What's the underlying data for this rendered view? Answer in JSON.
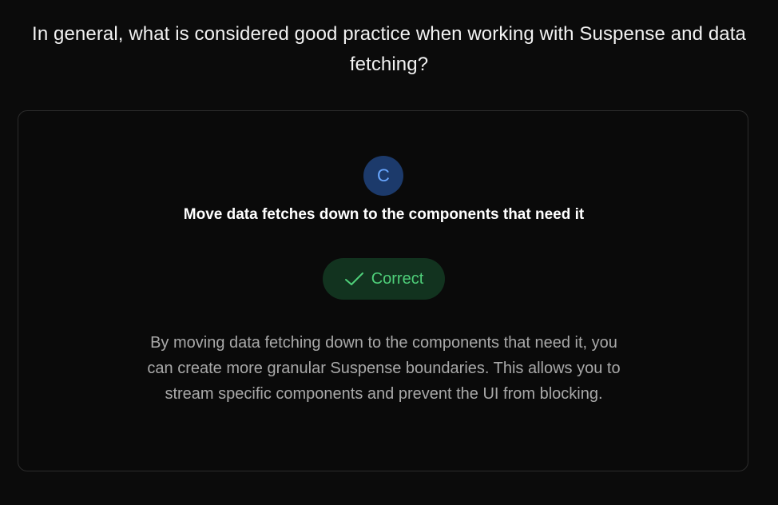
{
  "question": {
    "text": "In general, what is considered good practice when working with Suspense and data fetching?"
  },
  "result": {
    "choice_letter": "C",
    "answer_text": "Move data fetches down to the components that need it",
    "status_label": "Correct",
    "status_icon": "checkmark-icon",
    "explanation": "By moving data fetching down to the components that need it, you can create more granular Suspense boundaries. This allows you to stream specific components and prevent the UI from blocking."
  },
  "colors": {
    "background": "#0b0b0b",
    "card_border": "#2c2c2c",
    "choice_bg": "#1c3a6b",
    "choice_text": "#69a7ff",
    "correct_bg": "#12331f",
    "correct_text": "#4fd07a",
    "explanation_text": "#a9a9a9"
  }
}
